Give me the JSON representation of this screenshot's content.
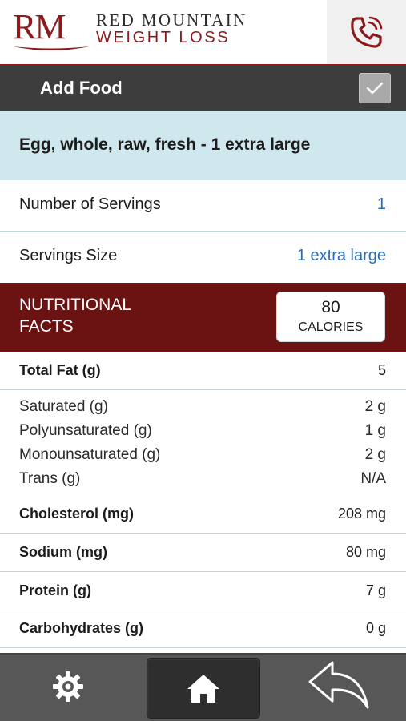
{
  "brand": {
    "logo_initials": "RM",
    "logo_line1": "RED MOUNTAIN",
    "logo_line2": "WEIGHT LOSS",
    "color_primary": "#8b1a1c"
  },
  "header": {
    "phone_icon": "phone-icon"
  },
  "titlebar": {
    "title": "Add Food",
    "confirm_icon": "check-icon"
  },
  "food": {
    "name": "Egg, whole, raw, fresh - 1 extra large"
  },
  "servings": {
    "number_label": "Number of Servings",
    "number_value": "1",
    "size_label": "Servings Size",
    "size_value": "1 extra large"
  },
  "nutrition": {
    "title_line1": "NUTRITIONAL",
    "title_line2": "FACTS",
    "calories_value": "80",
    "calories_label": "CALORIES",
    "total_fat": {
      "label": "Total Fat (g)",
      "value": "5"
    },
    "fat_breakdown": [
      {
        "label": "Saturated (g)",
        "value": "2 g"
      },
      {
        "label": "Polyunsaturated (g)",
        "value": "1 g"
      },
      {
        "label": "Monounsaturated (g)",
        "value": "2 g"
      },
      {
        "label": "Trans (g)",
        "value": "N/A"
      }
    ],
    "cholesterol": {
      "label": "Cholesterol (mg)",
      "value": "208 mg"
    },
    "sodium": {
      "label": "Sodium (mg)",
      "value": "80 mg"
    },
    "protein": {
      "label": "Protein (g)",
      "value": "7 g"
    },
    "carbohydrates": {
      "label": "Carbohydrates  (g)",
      "value": "0 g"
    }
  },
  "bottom_nav": {
    "settings_icon": "gear-icon",
    "home_icon": "home-icon",
    "back_icon": "back-arrow-icon"
  }
}
